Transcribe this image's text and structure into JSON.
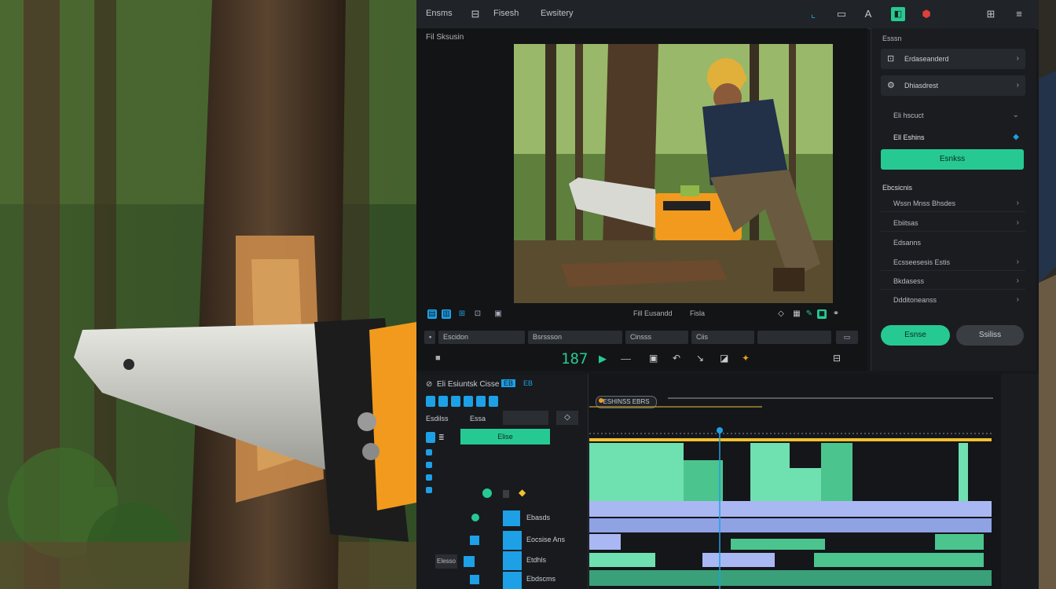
{
  "window": {
    "menu": [
      "Ensms",
      "Fisesh",
      "Ewsitery"
    ],
    "toolbar_icons": [
      "crop-icon",
      "frame-icon",
      "text-tool-icon",
      "effects-icon",
      "shield-icon",
      "grid-icon",
      "menu-icon"
    ]
  },
  "viewer": {
    "title": "Fil Sksusin",
    "controls_label": "Fill Eusandd",
    "sub_label": "Fisla",
    "row_cells": [
      "Escidon",
      "Bsrssson",
      "Cinsss",
      "Ciis"
    ],
    "frame_counter": "187"
  },
  "panel": {
    "heading": "Esssn",
    "items": [
      {
        "label": "Erdaseanderd",
        "icon": "monitor-icon"
      },
      {
        "label": "Dhiasdrest",
        "icon": "settings-icon"
      }
    ],
    "section_a": "Eli hscuct",
    "section_b": "Ell Eshins",
    "primary_button": "Esnkss",
    "section_c": "Ebcsicnis",
    "list": [
      "Wssn Mnss Bhsdes",
      "Ebiitsas",
      "Edsanns",
      "Ecsseesesis Estis",
      "Bkdasess",
      "Ddditoneanss"
    ],
    "ok_label": "Esnse",
    "cancel_label": "Ssiliss"
  },
  "timeline": {
    "title": "Eli Esiuntsk Cisse",
    "tabs": [
      "EB",
      "EB"
    ],
    "tool_labels": [
      "Esdilss",
      "Essa"
    ],
    "active_clip": "Elise",
    "clip_label": "ESHINSS EBRS",
    "tracks": [
      "Ebasds",
      "Eocsise Ans",
      "Etdhls",
      "Ebdscms"
    ],
    "extra_label": "Elesso"
  },
  "colors": {
    "accent": "#27c993",
    "blue": "#1ea0e6",
    "track": "#6fe0b0",
    "lavender": "#a9b8f2",
    "yellow": "#f2c12e",
    "orange": "#f29a1d"
  }
}
